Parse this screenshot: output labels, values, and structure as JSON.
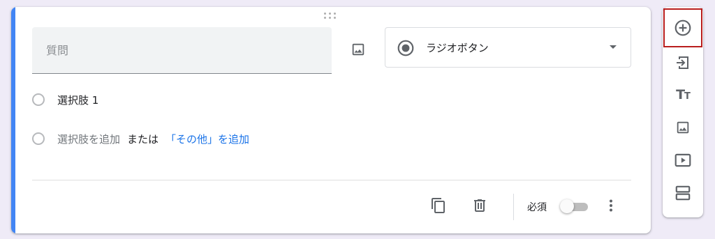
{
  "question": {
    "placeholder": "質問",
    "value": ""
  },
  "question_type": {
    "selected": "ラジオボタン",
    "icon": "radio-button-checked-icon"
  },
  "options": {
    "option_1_label": "選択肢 1",
    "add_option_label": "選択肢を追加",
    "or_label": "または",
    "add_other_label": "「その他」を追加"
  },
  "footer": {
    "duplicate_icon": "copy-icon",
    "delete_icon": "trash-icon",
    "required_label": "必須",
    "required_on": false,
    "more_icon": "more-vert-icon"
  },
  "side_toolbar": {
    "items": [
      {
        "name": "add-question",
        "icon": "plus-circle-icon",
        "highlighted": true
      },
      {
        "name": "import-questions",
        "icon": "import-icon"
      },
      {
        "name": "add-title",
        "icon": "title-tt-icon"
      },
      {
        "name": "add-image",
        "icon": "image-icon"
      },
      {
        "name": "add-video",
        "icon": "video-icon"
      },
      {
        "name": "add-section",
        "icon": "section-icon"
      }
    ]
  },
  "colors": {
    "accent": "#4285f4",
    "link": "#1a73e8",
    "highlight_border": "#b91d1d",
    "background": "#efebf7"
  }
}
